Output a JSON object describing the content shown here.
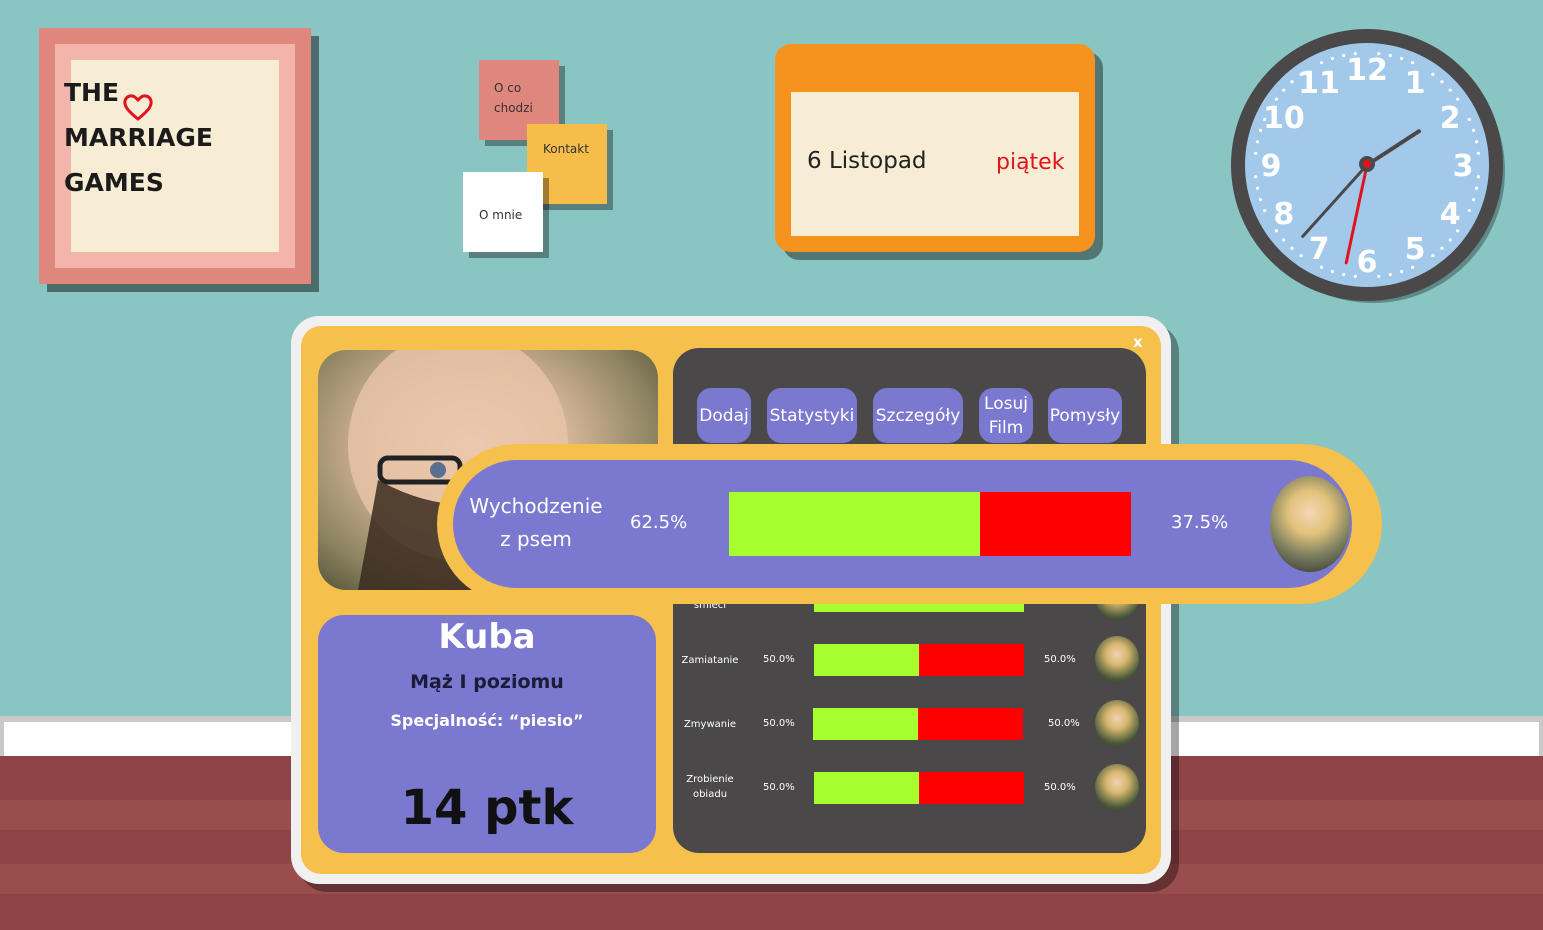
{
  "logo": {
    "line1": "THE",
    "line2": "MARRIAGE",
    "line3": "GAMES"
  },
  "notes": {
    "oco_line1": "O co",
    "oco_line2": "chodzi",
    "kontakt": "Kontakt",
    "omnie": "O mnie"
  },
  "calendar": {
    "date": "6 Listopad",
    "day": "piątek"
  },
  "clock": {
    "numbers": [
      "12",
      "1",
      "2",
      "3",
      "4",
      "5",
      "6",
      "7",
      "8",
      "9",
      "10",
      "11"
    ],
    "hour": 1.9,
    "minute": 37,
    "second": 32
  },
  "panel": {
    "close": "x"
  },
  "profile": {
    "name": "Kuba",
    "rank": "Mąż I poziomu",
    "specialty": "Specjalność: “piesio”",
    "points": "14 ptk"
  },
  "tabs": [
    {
      "label": "Dodaj"
    },
    {
      "label": "Statystyki"
    },
    {
      "label": "Szczegóły"
    },
    {
      "label1": "Losuj",
      "label2": "Film"
    },
    {
      "label": "Pomysły"
    }
  ],
  "popup": {
    "task_line1": "Wychodzenie",
    "task_line2": "z psem",
    "left_pct": "62.5%",
    "right_pct": "37.5%",
    "left_fraction": 0.625
  },
  "rows": [
    {
      "task": "śmieci",
      "left_pct": "",
      "right_pct": "",
      "left_fraction": 1.0
    },
    {
      "task": "Zamiatanie",
      "left_pct": "50.0%",
      "right_pct": "50.0%",
      "left_fraction": 0.5
    },
    {
      "task": "Zmywanie",
      "left_pct": "50.0%",
      "right_pct": "50.0%",
      "left_fraction": 0.5
    },
    {
      "task_line1": "Zrobienie",
      "task_line2": "obiadu",
      "left_pct": "50.0%",
      "right_pct": "50.0%",
      "left_fraction": 0.5
    }
  ],
  "colors": {
    "wall": "#89c5c2",
    "accent_orange": "#f6931f",
    "panel_yellow": "#f6c04d",
    "purple": "#7b78cf",
    "bar_green": "#a8ff2e",
    "bar_red": "#ff0000"
  }
}
